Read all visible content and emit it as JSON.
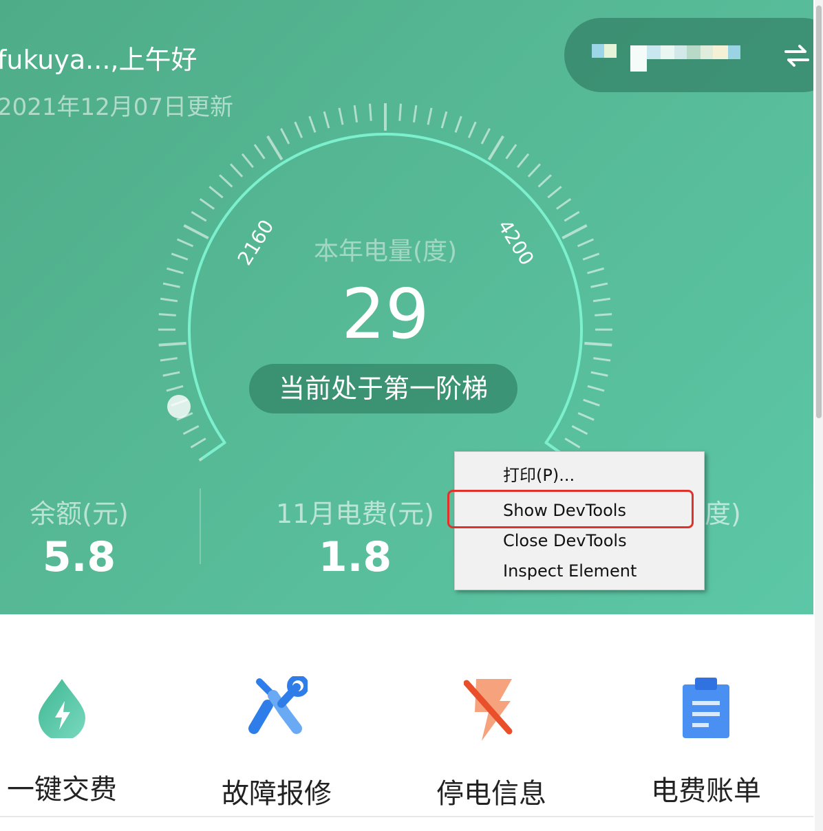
{
  "header": {
    "greeting": "fukuya...,上午好",
    "updated": "2021年12月07日更新"
  },
  "gauge": {
    "label": "本年电量(度)",
    "value": "29",
    "tick_low": "2160",
    "tick_high": "4200",
    "tier": "当前处于第一阶梯"
  },
  "stats": [
    {
      "label": "余额(元)",
      "value": "5.8"
    },
    {
      "label": "11月电费(元)",
      "value": "1.8"
    },
    {
      "label": "度)"
    }
  ],
  "context_menu": {
    "items": [
      "打印(P)...",
      "Show DevTools",
      "Close DevTools",
      "Inspect Element"
    ]
  },
  "actions": [
    {
      "label": "一键交费",
      "icon": "water-drop-bolt-icon"
    },
    {
      "label": "故障报修",
      "icon": "wrench-screwdriver-icon"
    },
    {
      "label": "停电信息",
      "icon": "power-outage-bolt-icon"
    },
    {
      "label": "电费账单",
      "icon": "clipboard-bill-icon"
    }
  ],
  "colors": {
    "hero_start": "#4fac88",
    "hero_end": "#5cc7a6",
    "highlight": "#e0322b",
    "icon_green": "#4fc1a0",
    "icon_blue": "#3d86f0",
    "icon_orange": "#f26a3d"
  }
}
